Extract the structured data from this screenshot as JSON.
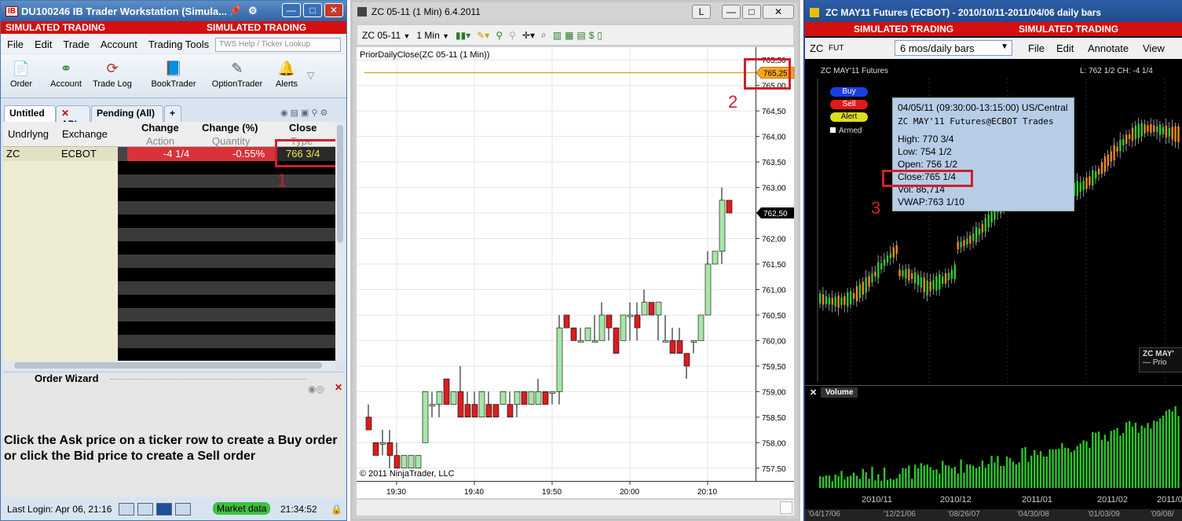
{
  "tws": {
    "title": "DU100246 IB Trader Workstation (Simula...",
    "logo": "IB",
    "sim1": "SIMULATED TRADING",
    "sim2": "SIMULATED TRADING",
    "menu": [
      "File",
      "Edit",
      "Trade",
      "Account",
      "Trading Tools"
    ],
    "search_placeholder": "TWS Help / Ticker Lookup",
    "toolbar": [
      "Order",
      "Account",
      "Trade Log",
      "BookTrader",
      "OptionTrader",
      "Alerts"
    ],
    "tabs": [
      "Untitled",
      "API",
      "Pending (All)",
      "+"
    ],
    "headers": {
      "undrlyng": "Undrlyng",
      "exchange": "Exchange",
      "change": "Change",
      "change_pct": "Change (%)",
      "close": "Close",
      "action": "Action",
      "quantity": "Quantity",
      "type": "Type"
    },
    "row": {
      "symbol": "ZC",
      "exchange": "ECBOT",
      "change": "-4 1/4",
      "change_pct": "-0.55%",
      "close": "766 3/4"
    },
    "wizard_title": "Order Wizard",
    "wizard_text1": "Click the Ask price on a ticker row to create a Buy order",
    "wizard_text2": "or click the Bid price to create a Sell order",
    "last_login": "Last Login: Apr 06, 21:16",
    "market_data": "Market data",
    "clock": "21:34:52",
    "annotation": "1"
  },
  "nt": {
    "title": "ZC 05-11 (1 Min)  6.4.2011",
    "instrument": "ZC 05-11",
    "interval": "1 Min",
    "indicator": "PriorDailyClose(ZC 05-11 (1 Min))",
    "copyright": "© 2011 NinjaTrader, LLC",
    "prior_close_label": "765,25",
    "last_label": "762,50",
    "yticks": [
      "765,50",
      "765,00",
      "764,50",
      "764,00",
      "763,50",
      "763,00",
      "762,50",
      "762,00",
      "761,50",
      "761,00",
      "760,50",
      "760,00",
      "759,50",
      "759,00",
      "758,50",
      "758,00",
      "757,50"
    ],
    "xticks": [
      "19:30",
      "19:40",
      "19:50",
      "20:00",
      "20:10"
    ],
    "btn_l": "L",
    "annotation": "2"
  },
  "ib": {
    "title": "ZC MAY11 Futures (ECBOT) - 2010/10/11-2011/04/06 daily bars",
    "sim1": "SIMULATED TRADING",
    "sim2": "SIMULATED TRADING",
    "symbol": "ZC",
    "sectype": "FUT",
    "period": "6 mos/daily bars",
    "menu": [
      "File",
      "Edit",
      "Annotate",
      "View"
    ],
    "chart_label": "ZC MAY'11 Futures",
    "chart_stats": "L: 762 1/2 CH: -4 1/4",
    "buy": "Buy",
    "sell": "Sell",
    "alert": "Alert",
    "armed": "Armed",
    "tip": {
      "range": "04/05/11 (09:30:00-13:15:00) US/Central",
      "name": "ZC MAY'11 Futures@ECBOT Trades",
      "high": "High:  770 3/4",
      "low": "Low:   754 1/2",
      "open": "Open: 756 1/2",
      "close": "Close:765 1/4",
      "vol": "Vol:    86,714",
      "vwap": "VWAP:763 1/10"
    },
    "legend_title": "ZC MAY'",
    "legend_sub": "— Prio",
    "volume": "Volume",
    "months": [
      "2010/11",
      "2010/12",
      "2011/01",
      "2011/02",
      "2011/0"
    ],
    "dates": [
      "'04/17/06",
      "'12/21/06",
      "'08/26/07",
      "'04/30/08",
      "'01/03/09",
      "'09/08/"
    ],
    "annotation": "3"
  },
  "colors": {
    "up": "#a8e6a8",
    "down": "#d81e1e",
    "simred": "#d40f0f",
    "annot": "#d0202a"
  },
  "chart_data": {
    "type": "candlestick",
    "instrument": "ZC 05-11",
    "interval": "1 Min",
    "prior_daily_close": 765.25,
    "last": 762.5,
    "ylim": [
      757.25,
      765.75
    ],
    "x": [
      "19:30",
      "19:40",
      "19:50",
      "20:00",
      "20:10"
    ],
    "series": [
      {
        "name": "ZC 05-11",
        "ohlc": [
          [
            758.5,
            758.75,
            758.25,
            758.25
          ],
          [
            758.0,
            758.0,
            757.75,
            757.75
          ],
          [
            758.0,
            758.25,
            757.75,
            758.0
          ],
          [
            758.0,
            758.25,
            757.5,
            757.75
          ],
          [
            757.75,
            758.0,
            757.5,
            757.5
          ],
          [
            757.5,
            757.75,
            757.5,
            757.75
          ],
          [
            757.5,
            757.75,
            757.5,
            757.75
          ],
          [
            757.5,
            757.75,
            757.5,
            757.75
          ],
          [
            758.0,
            759.0,
            758.0,
            759.0
          ],
          [
            758.75,
            759.0,
            758.5,
            758.75
          ],
          [
            758.75,
            759.0,
            758.5,
            759.0
          ],
          [
            759.25,
            759.25,
            758.75,
            758.75
          ],
          [
            758.75,
            759.0,
            758.75,
            759.0
          ],
          [
            759.0,
            759.5,
            758.75,
            758.5
          ],
          [
            758.75,
            759.0,
            758.75,
            758.5
          ],
          [
            758.75,
            759.0,
            758.5,
            758.5
          ],
          [
            758.5,
            759.0,
            758.5,
            759.0
          ],
          [
            758.75,
            759.0,
            758.75,
            758.5
          ],
          [
            758.75,
            758.75,
            758.5,
            758.5
          ],
          [
            758.75,
            759.0,
            758.75,
            759.0
          ],
          [
            758.75,
            759.0,
            758.75,
            758.5
          ],
          [
            758.75,
            759.0,
            758.5,
            759.0
          ],
          [
            759.0,
            759.0,
            758.75,
            758.75
          ],
          [
            758.75,
            759.0,
            758.75,
            759.0
          ],
          [
            758.75,
            759.25,
            758.75,
            759.0
          ],
          [
            759.0,
            759.0,
            758.75,
            758.75
          ],
          [
            759.0,
            759.0,
            758.75,
            759.0
          ],
          [
            759.0,
            760.5,
            758.75,
            760.25
          ],
          [
            760.5,
            760.5,
            760.25,
            760.25
          ],
          [
            760.25,
            760.25,
            760.0,
            760.0
          ],
          [
            760.0,
            760.25,
            760.0,
            760.0
          ],
          [
            760.0,
            760.25,
            760.0,
            760.25
          ],
          [
            760.0,
            760.5,
            760.0,
            760.0
          ],
          [
            760.0,
            760.75,
            760.0,
            760.5
          ],
          [
            760.5,
            760.5,
            760.0,
            760.25
          ],
          [
            760.25,
            760.25,
            759.75,
            759.75
          ],
          [
            760.0,
            760.5,
            760.0,
            760.5
          ],
          [
            760.5,
            760.75,
            760.0,
            760.5
          ],
          [
            760.5,
            760.75,
            760.0,
            760.25
          ],
          [
            760.5,
            761.0,
            760.5,
            760.75
          ],
          [
            760.75,
            760.75,
            760.5,
            760.5
          ],
          [
            760.5,
            760.75,
            760.0,
            760.75
          ],
          [
            760.0,
            760.5,
            760.0,
            760.0
          ],
          [
            760.0,
            760.25,
            760.0,
            759.75
          ],
          [
            760.0,
            760.25,
            759.75,
            759.75
          ],
          [
            759.75,
            759.75,
            759.25,
            759.5
          ],
          [
            760.0,
            760.0,
            759.75,
            760.0
          ],
          [
            760.0,
            760.5,
            760.0,
            760.5
          ],
          [
            760.5,
            761.75,
            760.5,
            761.5
          ],
          [
            761.5,
            761.75,
            761.5,
            761.75
          ],
          [
            761.75,
            763.0,
            761.5,
            762.75
          ],
          [
            762.75,
            762.75,
            762.5,
            762.5
          ]
        ]
      }
    ]
  }
}
